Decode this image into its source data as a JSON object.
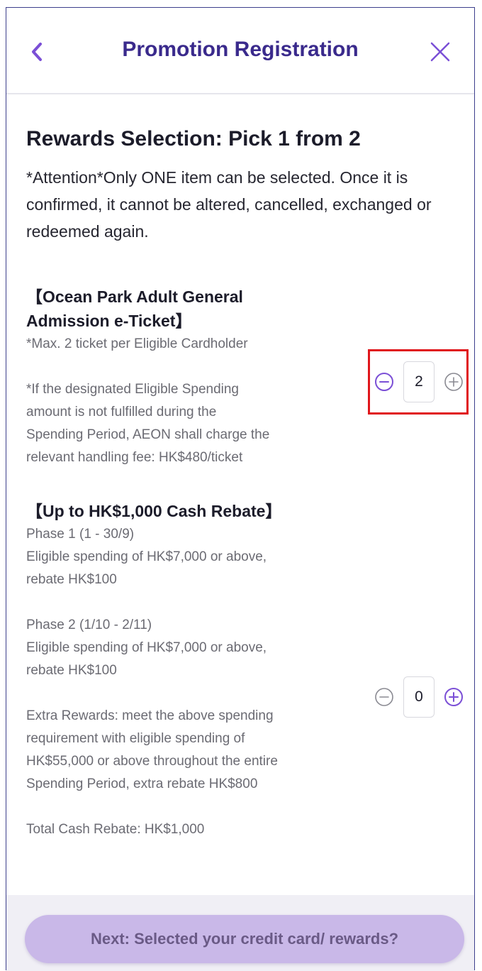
{
  "header": {
    "title": "Promotion Registration"
  },
  "main": {
    "section_title": "Rewards Selection: Pick 1 from 2",
    "attention": "*Attention*Only ONE item can be selected. Once it is confirmed, it cannot be altered, cancelled, exchanged or redeemed again."
  },
  "rewards": [
    {
      "title_line1": "【Ocean Park Adult General",
      "title_line2": "Admission e-Ticket】",
      "desc": [
        "*Max. 2 ticket per Eligible Cardholder",
        "",
        "*If the designated Eligible Spending",
        "amount is not fulfilled during the",
        "Spending Period, AEON shall charge the",
        "relevant handling fee: HK$480/ticket"
      ],
      "quantity": "2"
    },
    {
      "title_line1": "【Up to HK$1,000 Cash Rebate】",
      "desc": [
        "Phase 1 (1 - 30/9)",
        "Eligible spending of HK$7,000 or above,",
        "rebate HK$100",
        "",
        "Phase 2 (1/10 - 2/11)",
        "Eligible spending of HK$7,000 or above,",
        "rebate HK$100",
        "",
        "Extra Rewards: meet the above spending",
        "requirement with eligible spending of",
        "HK$55,000 or above throughout the entire",
        "Spending Period, extra rebate HK$800",
        "",
        "Total Cash Rebate: HK$1,000"
      ],
      "quantity": "0"
    }
  ],
  "footer": {
    "next_label": "Next: Selected your credit card/ rewards?"
  },
  "colors": {
    "accent": "#7b4fd6",
    "title": "#3a2a8c",
    "highlight": "#e0161b"
  },
  "icons": [
    "chevron-left-icon",
    "close-icon",
    "minus-circle-icon",
    "plus-circle-icon"
  ]
}
